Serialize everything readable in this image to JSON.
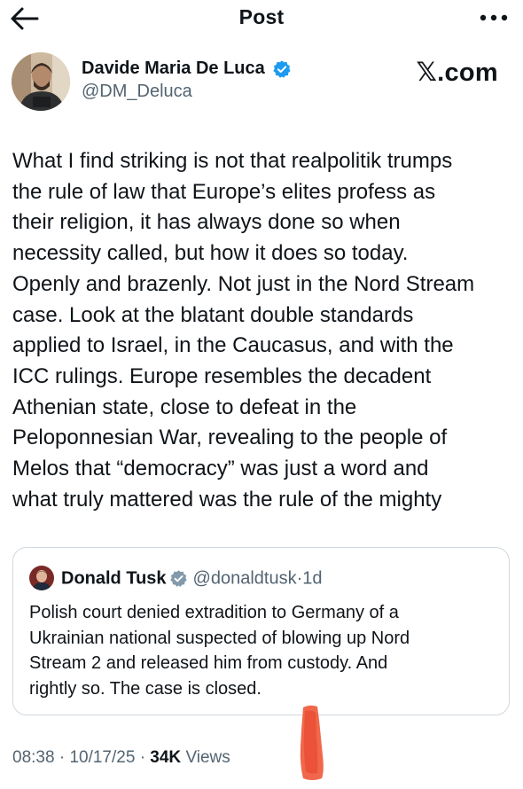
{
  "header": {
    "title": "Post",
    "back_icon": "arrow-left-icon",
    "more_icon": "more-horizontal-icon"
  },
  "author": {
    "name": "Davide Maria De Luca",
    "handle": "@DM_Deluca",
    "verified": true
  },
  "source_brand": "𝕏.com",
  "post": {
    "lines": [
      "What I find striking is not that realpolitik trumps",
      "the rule of law that Europe’s elites profess as",
      "their religion, it has always done so when",
      "necessity called, but how it does so today.",
      "Openly and brazenly. Not just in the Nord Stream",
      "case. Look at the blatant double standards",
      "applied to Israel, in the Caucasus, and with the",
      "ICC rulings. Europe resembles the decadent",
      "Athenian state, close to defeat in the",
      "Peloponnesian War, revealing to the people of",
      "Melos that “democracy” was just a word and",
      "what truly mattered was the rule of the mighty"
    ]
  },
  "quote": {
    "name": "Donald Tusk",
    "handle": "@donaldtusk",
    "separator": "·",
    "age": "1d",
    "verified": true,
    "lines": [
      "Polish court denied extradition to Germany of a",
      "Ukrainian national suspected of blowing up Nord",
      "Stream 2 and released him from custody. And",
      "rightly so. The case is closed."
    ]
  },
  "meta": {
    "time": "08:38",
    "separator": "·",
    "date": "10/17/25",
    "views_count": "34K",
    "views_label": "Views"
  },
  "colors": {
    "text": "#0f1419",
    "secondary": "#536471",
    "verified_badge": "#1d9bf0",
    "border": "#cfd9de",
    "redaction_mark": "#f05a3c"
  }
}
